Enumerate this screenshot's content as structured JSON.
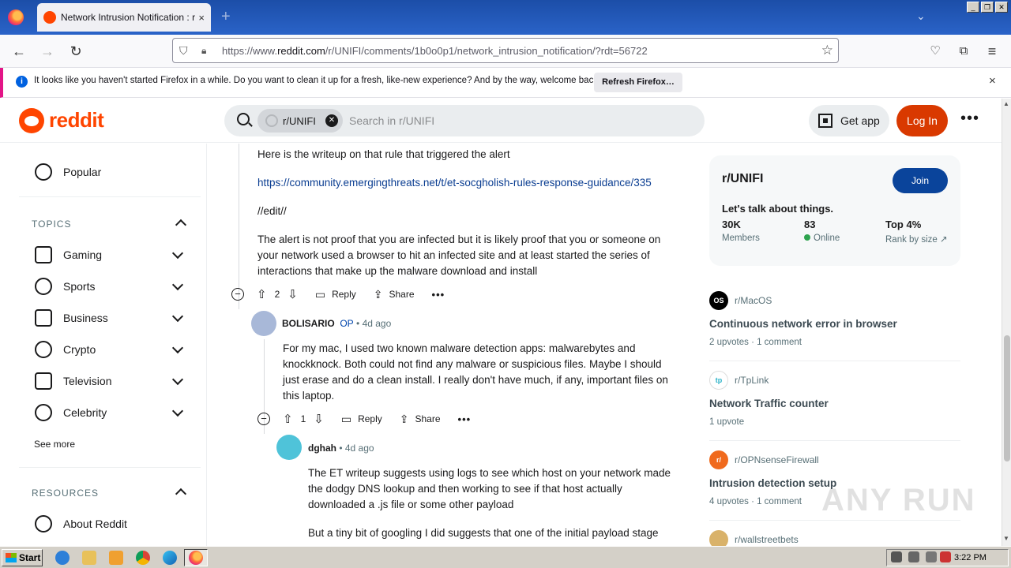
{
  "browser": {
    "tab_title": "Network Intrusion Notification : r/UNIFI",
    "url_prefix": "https://www.",
    "url_domain": "reddit.com",
    "url_path": "/r/UNIFI/comments/1b0o0p1/network_intrusion_notification/?rdt=56722",
    "new_tab": "+",
    "close": "×"
  },
  "notification": {
    "text": "It looks like you haven't started Firefox in a while. Do you want to clean it up for a fresh, like-new experience? And by the way, welcome back!",
    "button": "Refresh Firefox…",
    "close": "×"
  },
  "header": {
    "logo_text": "reddit",
    "search_chip": "r/UNIFI",
    "search_placeholder": "Search in r/UNIFI",
    "get_app": "Get app",
    "login": "Log In",
    "more": "•••"
  },
  "sidebar": {
    "popular": "Popular",
    "topics_heading": "TOPICS",
    "topics": [
      "Gaming",
      "Sports",
      "Business",
      "Crypto",
      "Television",
      "Celebrity"
    ],
    "see_more": "See more",
    "resources_heading": "RESOURCES",
    "about": "About Reddit"
  },
  "comments": {
    "c1_line0": "Here is the writeup on that rule that triggered the alert",
    "c1_link": "https://community.emergingthreats.net/t/et-socgholish-rules-response-guidance/335",
    "c1_edit": "//edit//",
    "c1_p1": "The alert is not proof that you are infected but it is likely proof that you or someone on",
    "c1_p2": "your network used a browser to hit an infected site and at least started the series of",
    "c1_p3": "interactions that make up the malware download and install",
    "c1_votes": "2",
    "reply": "Reply",
    "share": "Share",
    "c2_author": "BOLISARIO",
    "c2_op": "OP",
    "c2_time": "• 4d ago",
    "c2_l1": "For my mac, I used two known malware detection apps: malwarebytes and",
    "c2_l2": "knockknock. Both could not find any malware or suspicious files. Maybe I should",
    "c2_l3": "just erase and do a clean install. I really don't have much, if any, important files on",
    "c2_l4": "this laptop.",
    "c2_votes": "1",
    "c3_author": "dghah",
    "c3_time": "• 4d ago",
    "c3_l1": "The ET writeup suggests using logs to see which host on your network made",
    "c3_l2": "the dodgy DNS lookup and then working to see if that host actually",
    "c3_l3": "downloaded a .js file or some other payload",
    "c3_l4": "But a tiny bit of googling I did suggests that one of the initial payload stage"
  },
  "community": {
    "name": "r/UNIFI",
    "join": "Join",
    "description": "Let's talk about things.",
    "members_value": "30K",
    "members_label": "Members",
    "online_value": "83",
    "online_label": "Online",
    "rank_value": "Top 4%",
    "rank_label": "Rank by size"
  },
  "related": [
    {
      "sub": "r/MacOS",
      "title": "Continuous network error in browser",
      "meta": "2 upvotes  ·  1 comment",
      "avatar": "OS"
    },
    {
      "sub": "r/TpLink",
      "title": "Network Traffic counter",
      "meta": "1 upvote",
      "avatar": "tp"
    },
    {
      "sub": "r/OPNsenseFirewall",
      "title": "Intrusion detection setup",
      "meta": "4 upvotes  ·  1 comment",
      "avatar": "r/"
    },
    {
      "sub": "r/wallstreetbets",
      "title": "",
      "meta": "",
      "avatar": ""
    }
  ],
  "watermark": "ANY RUN",
  "taskbar": {
    "start": "Start",
    "time": "3:22 PM"
  },
  "colors": {
    "reddit_orange": "#ff4500",
    "login_bg": "#d93900",
    "join_bg": "#0a449b",
    "link": "#0a3d91"
  }
}
